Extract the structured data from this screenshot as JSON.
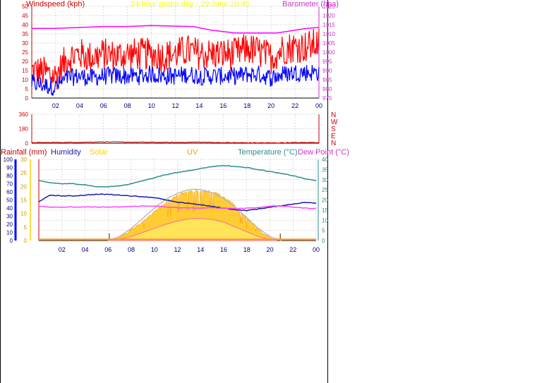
{
  "header": {
    "windspeed_label": "Windspeed (kph)",
    "title": "24 hour graph day - 29 June 20:45",
    "barometer_label": "Barometer (hpa)"
  },
  "colors": {
    "gust": "#ff0000",
    "average_wind": "#0000ff",
    "barometer": "#ff00ff",
    "direction": "#ff0000",
    "temperature": "#2e8b8b",
    "humidity": "#1a1aaa",
    "dew_point": "#ff44ff",
    "solar": "#ffcc00",
    "uv": "#ff9900",
    "rainfall": "#cc0000",
    "grid": "#cccccc"
  },
  "bottom_legend": {
    "rainfall": "Rainfall (mm)",
    "humidity": "Humidity",
    "solar": "Solar",
    "uv": "UV",
    "temperature": "Temperature (°C)",
    "dew_point": "Dew Point (°C)"
  },
  "compass": [
    "N",
    "W",
    "S",
    "E",
    "N"
  ],
  "chart_data": [
    {
      "type": "line",
      "x_ticks": [
        "02",
        "04",
        "06",
        "08",
        "10",
        "12",
        "14",
        "16",
        "18",
        "20",
        "22",
        "00"
      ],
      "y_left_ticks": [
        0,
        5,
        10,
        15,
        20,
        25,
        30,
        35,
        40,
        45,
        50
      ],
      "y_right_ticks": [
        975,
        980,
        985,
        990,
        995,
        1000,
        1005,
        1010,
        1015,
        1020,
        1025
      ],
      "ylim_left": [
        0,
        50
      ],
      "ylim_right": [
        975,
        1025
      ],
      "xlim_hours": [
        0,
        24
      ],
      "series": [
        {
          "name": "Windspeed (kph)",
          "type": "gust",
          "hours": [
            0,
            1,
            2,
            3,
            4,
            5,
            6,
            7,
            8,
            9,
            10,
            11,
            12,
            13,
            14,
            15,
            16,
            17,
            18,
            19,
            20,
            21,
            22,
            23,
            24
          ],
          "values": [
            15,
            14,
            12,
            22,
            24,
            22,
            24,
            23,
            24,
            24,
            24,
            23,
            24,
            26,
            24,
            24,
            24,
            24,
            27,
            25,
            22,
            27,
            28,
            28,
            30
          ]
        },
        {
          "type": "average",
          "hours": [
            0,
            1,
            2,
            3,
            4,
            5,
            6,
            7,
            8,
            9,
            10,
            11,
            12,
            13,
            14,
            15,
            16,
            17,
            18,
            19,
            20,
            21,
            22,
            23,
            24
          ],
          "values": [
            8,
            7,
            6,
            11,
            12,
            11,
            12,
            12,
            12,
            12,
            13,
            12,
            12,
            13,
            12,
            12,
            12,
            12,
            13,
            13,
            11,
            13,
            14,
            14,
            14
          ]
        },
        {
          "name": "Barometer (hpa)",
          "hours": [
            0,
            2,
            4,
            6,
            8,
            10,
            12,
            13.5,
            15,
            17,
            19,
            20.5,
            21.5,
            23,
            24
          ],
          "values": [
            1013,
            1013,
            1013.5,
            1014,
            1014,
            1014.5,
            1014.2,
            1014,
            1012,
            1010.5,
            1010.5,
            1010.5,
            1011.5,
            1013,
            1013.5
          ]
        }
      ]
    },
    {
      "type": "scatter",
      "x_ticks": [
        "02",
        "04",
        "06",
        "08",
        "10",
        "12",
        "14",
        "16",
        "18",
        "20",
        "22",
        "00"
      ],
      "y_ticks": [
        0,
        180,
        360
      ],
      "ylim": [
        0,
        360
      ],
      "series": [
        {
          "hours": [
            0,
            2,
            4,
            6,
            8,
            10,
            12,
            14,
            16,
            18,
            20,
            22,
            24
          ],
          "values": [
            8,
            10,
            12,
            18,
            14,
            12,
            10,
            14,
            8,
            6,
            5,
            8,
            10
          ]
        }
      ]
    },
    {
      "type": "area",
      "x_ticks": [
        "02",
        "04",
        "06",
        "08",
        "10",
        "12",
        "14",
        "16",
        "18",
        "20",
        "22",
        "00"
      ],
      "y_humidity_ticks": [
        0,
        10,
        20,
        30,
        40,
        50,
        60,
        70,
        80,
        90,
        100
      ],
      "y_solar_ticks": [
        0,
        5,
        10,
        15,
        20,
        25,
        30
      ],
      "y_temp_ticks": [
        0,
        5,
        10,
        15,
        20,
        25,
        30,
        35,
        40
      ],
      "ylim_humidity": [
        0,
        100
      ],
      "ylim_solar": [
        0,
        30
      ],
      "ylim_temp": [
        0,
        40
      ],
      "series": [
        {
          "name": "Temperature (°C)",
          "hours": [
            0,
            1,
            2,
            3,
            4,
            5,
            6,
            7,
            8,
            9,
            10,
            11,
            12,
            13,
            14,
            15,
            16,
            17,
            18,
            19,
            20,
            21,
            22,
            23,
            24
          ],
          "values": [
            29.5,
            28.5,
            28,
            28,
            27.5,
            26.5,
            26.5,
            27,
            28,
            29.5,
            31,
            32.5,
            33.5,
            34.5,
            35.5,
            36.5,
            37,
            36.5,
            36,
            35,
            34,
            33,
            32,
            30.5,
            29.5
          ]
        },
        {
          "name": "Humidity",
          "hours": [
            0,
            1,
            2,
            3,
            4,
            5,
            6,
            7,
            8,
            9,
            10,
            11,
            12,
            13,
            14,
            15,
            16,
            17,
            18,
            19,
            20,
            21,
            22,
            23,
            24
          ],
          "values": [
            48,
            56,
            55,
            55,
            56,
            57,
            57,
            56,
            55,
            54,
            53,
            50,
            47,
            46,
            44,
            42,
            40,
            38,
            37,
            39,
            41,
            43,
            45,
            47,
            46
          ]
        },
        {
          "name": "Dew Point (°C)",
          "hours": [
            0,
            1,
            2,
            3,
            4,
            5,
            6,
            7,
            8,
            9,
            10,
            11,
            12,
            13,
            14,
            15,
            16,
            17,
            18,
            19,
            20,
            21,
            22,
            23,
            24
          ],
          "values": [
            17,
            16.5,
            16.5,
            16.5,
            16.5,
            16.5,
            16.5,
            16.5,
            16.8,
            17,
            17,
            16.5,
            16.2,
            16,
            16,
            16.2,
            16,
            15.8,
            16,
            16.2,
            17,
            17,
            16.5,
            16,
            15.8
          ]
        },
        {
          "name": "Solar",
          "hours": [
            6,
            6.7,
            7.3,
            8,
            8.7,
            9.3,
            10,
            10.7,
            11.3,
            12,
            12.7,
            13.3,
            14,
            14.7,
            15.3,
            16,
            16.7,
            17.3,
            18,
            18.7,
            19.3,
            20,
            20.6
          ],
          "values": [
            0,
            0.8,
            2,
            3.8,
            6,
            8,
            10.5,
            13,
            15,
            16.8,
            17.8,
            18.2,
            18.5,
            18.2,
            17.5,
            16,
            14,
            11,
            8,
            5.5,
            3,
            1,
            0
          ]
        },
        {
          "type": "uv",
          "hours": [
            6,
            7,
            8,
            9,
            10,
            11,
            12,
            13,
            14,
            15,
            16,
            17,
            18,
            19,
            20,
            20.6
          ],
          "values": [
            0,
            0.5,
            1.5,
            3,
            4.5,
            6,
            7.2,
            8,
            8.2,
            7.8,
            6.8,
            5,
            3.2,
            1.5,
            0.4,
            0
          ]
        },
        {
          "type": "clear-sky",
          "hours": [
            6,
            7,
            8,
            9,
            10,
            11,
            12,
            13,
            13.5,
            14,
            15,
            16,
            17,
            18,
            19,
            20,
            21
          ],
          "values": [
            0,
            1.5,
            4.5,
            8.2,
            12,
            15.3,
            17.5,
            18.8,
            19,
            18.8,
            17.7,
            15.5,
            12.3,
            8.5,
            4.5,
            1.5,
            0
          ]
        }
      ]
    }
  ]
}
